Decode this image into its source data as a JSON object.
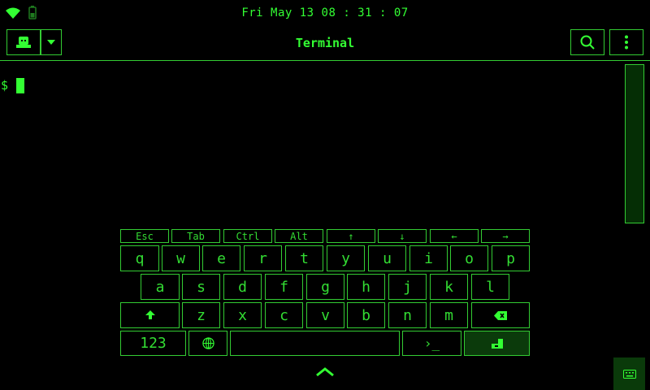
{
  "status": {
    "datetime": "Fri May 13 08 : 31 : 07"
  },
  "titlebar": {
    "title": "Terminal"
  },
  "terminal": {
    "prompt": "$"
  },
  "keyboard": {
    "modifier_keys": [
      "Esc",
      "Tab",
      "Ctrl",
      "Alt",
      "↑",
      "↓",
      "←",
      "→"
    ],
    "row1": [
      "q",
      "w",
      "e",
      "r",
      "t",
      "y",
      "u",
      "i",
      "o",
      "p"
    ],
    "row2": [
      "a",
      "s",
      "d",
      "f",
      "g",
      "h",
      "j",
      "k",
      "l"
    ],
    "row3": [
      "z",
      "x",
      "c",
      "v",
      "b",
      "n",
      "m"
    ],
    "numbers_label": "123",
    "terminal_key_label": "›_"
  },
  "colors": {
    "accent": "#33ff33",
    "background": "#000000",
    "border": "#33cc33"
  },
  "icons": [
    "wifi-icon",
    "battery-icon",
    "terminal-session-icon",
    "dropdown-arrow-icon",
    "search-icon",
    "more-vert-icon",
    "shift-icon",
    "backspace-icon",
    "globe-icon",
    "enter-icon",
    "chevron-up-icon",
    "keyboard-icon"
  ]
}
